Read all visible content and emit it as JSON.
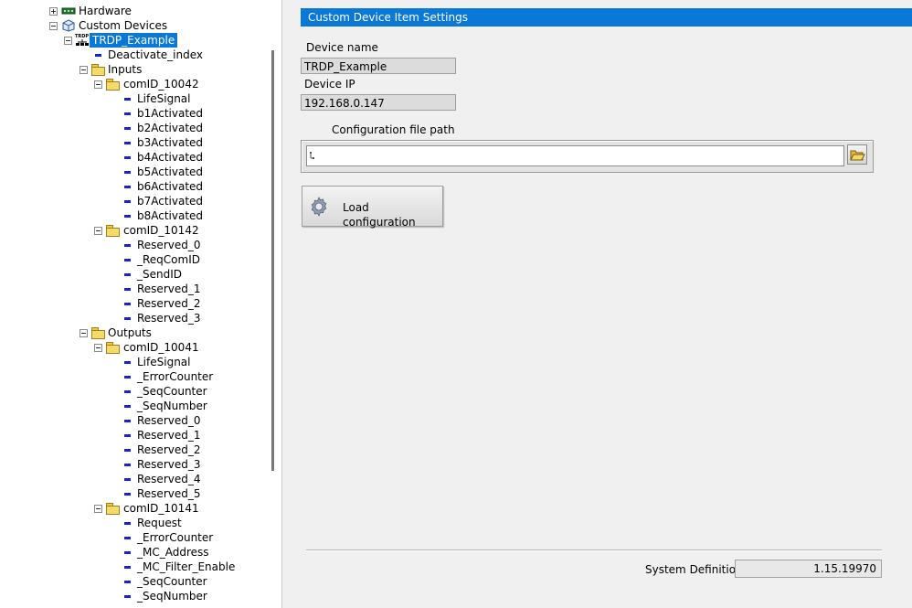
{
  "tree": {
    "hardware": "Hardware",
    "custom_devices": "Custom Devices",
    "device": "TRDP_Example",
    "device_icon_text": "TRDP",
    "deactivate_index": "Deactivate_index",
    "inputs": "Inputs",
    "inputs_groups": [
      {
        "label": "comID_10042",
        "items": [
          "LifeSignal",
          "b1Activated",
          "b2Activated",
          "b3Activated",
          "b4Activated",
          "b5Activated",
          "b6Activated",
          "b7Activated",
          "b8Activated"
        ]
      },
      {
        "label": "comID_10142",
        "items": [
          "Reserved_0",
          "_ReqComID",
          "_SendID",
          "Reserved_1",
          "Reserved_2",
          "Reserved_3"
        ]
      }
    ],
    "outputs": "Outputs",
    "outputs_groups": [
      {
        "label": "comID_10041",
        "items": [
          "LifeSignal",
          "_ErrorCounter",
          "_SeqCounter",
          "_SeqNumber",
          "Reserved_0",
          "Reserved_1",
          "Reserved_2",
          "Reserved_3",
          "Reserved_4",
          "Reserved_5"
        ]
      },
      {
        "label": "comID_10141",
        "items": [
          "Request",
          "_ErrorCounter",
          "_MC_Address",
          "_MC_Filter_Enable",
          "_SeqCounter",
          "_SeqNumber"
        ]
      }
    ]
  },
  "settings": {
    "header": "Custom Device Item Settings",
    "device_name_label": "Device name",
    "device_name_value": "TRDP_Example",
    "device_ip_label": "Device IP",
    "device_ip_value": "192.168.0.147",
    "config_path_label": "Configuration file path",
    "config_path_value": "",
    "load_button": "Load configuration",
    "system_definition_label": "System Definition:",
    "system_definition_value": "1.15.19970"
  },
  "icons": {
    "hardware": "hardware-board-icon",
    "custom_devices": "cube-icon",
    "device": "network-device-icon",
    "folder": "folder-icon",
    "leaf": "channel-dash-icon",
    "browse": "open-folder-icon",
    "load": "gear-icon"
  },
  "colors": {
    "selection": "#0a78d7",
    "header_bar": "#0a78d7",
    "leaf_dash": "#1226c7",
    "folder": "#f6d967"
  }
}
